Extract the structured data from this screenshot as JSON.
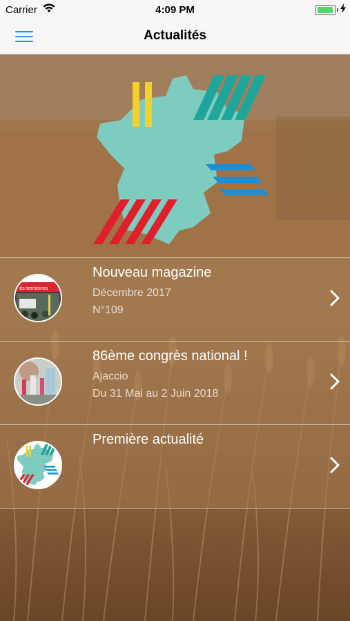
{
  "status_bar": {
    "carrier": "Carrier",
    "time": "4:09 PM"
  },
  "nav": {
    "title": "Actualités"
  },
  "news": [
    {
      "title": "Nouveau magazine",
      "line1": "Décembre 2017",
      "line2": "N°109"
    },
    {
      "title": "86ème congrès national !",
      "line1": "Ajaccio",
      "line2": "Du 31 Mai au 2 Juin 2018"
    },
    {
      "title": "Première actualité",
      "line1": "",
      "line2": ""
    }
  ],
  "thumb_text": {
    "magazine": "és territoires"
  },
  "colors": {
    "accent": "#3b86d8",
    "map_teal": "#7ecbbf",
    "stripe_yellow": "#f2d12b",
    "stripe_teal": "#1fa69b",
    "stripe_blue": "#1e8fd4",
    "stripe_red": "#e01f2d"
  },
  "icons": [
    "wifi-icon",
    "battery-icon",
    "menu-icon",
    "chevron-right-icon"
  ]
}
